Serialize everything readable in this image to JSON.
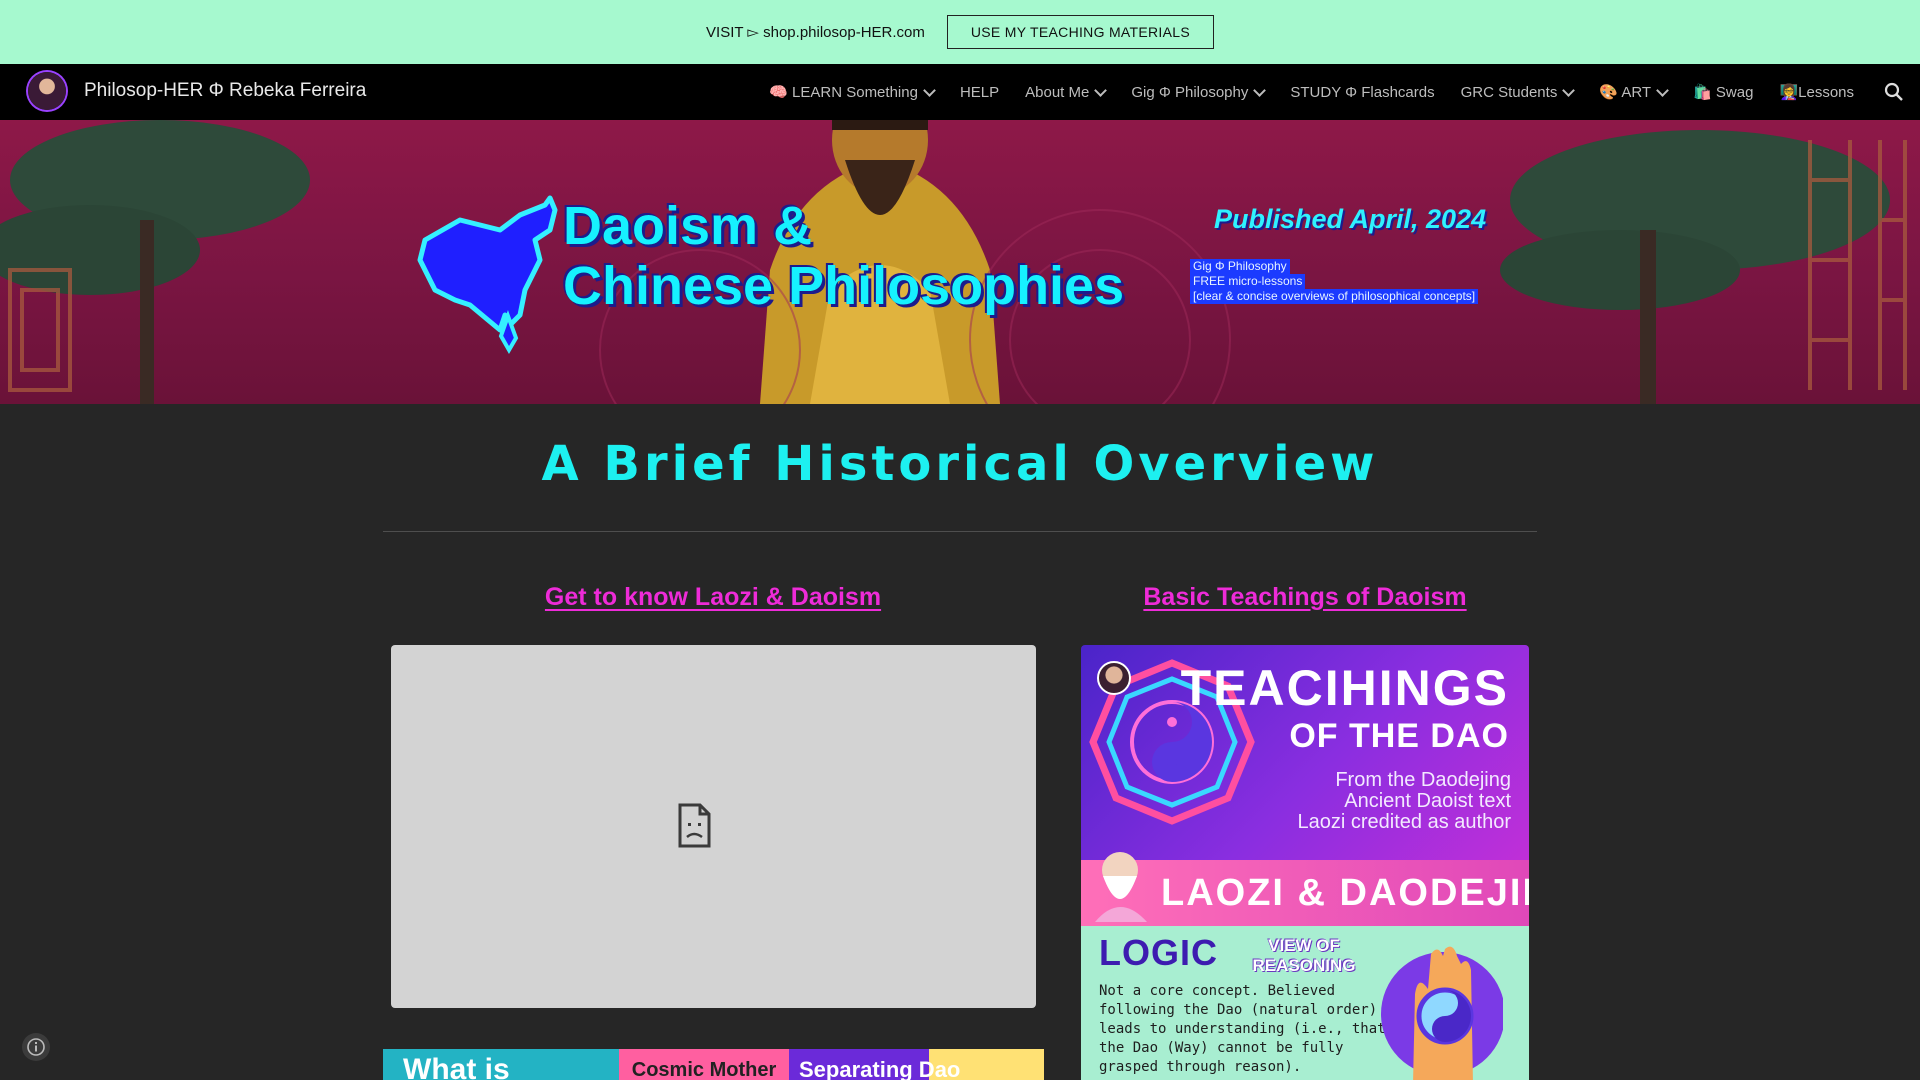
{
  "promo": {
    "text": "VISIT ▻ shop.philosop-HER.com",
    "button_label": "USE MY TEACHING MATERIALS"
  },
  "header": {
    "site_title": "Philosop-HER Φ Rebeka Ferreira",
    "nav": [
      {
        "label": "🧠 LEARN Something",
        "has_dropdown": true
      },
      {
        "label": "HELP",
        "has_dropdown": false
      },
      {
        "label": "About Me",
        "has_dropdown": true
      },
      {
        "label": "Gig Φ Philosophy",
        "has_dropdown": true
      },
      {
        "label": "STUDY Φ Flashcards",
        "has_dropdown": false
      },
      {
        "label": "GRC Students",
        "has_dropdown": true
      },
      {
        "label": "🎨 ART",
        "has_dropdown": true
      },
      {
        "label": "🛍️ Swag",
        "has_dropdown": false
      },
      {
        "label": "👩‍🏫Lessons",
        "has_dropdown": false
      }
    ]
  },
  "hero": {
    "title_line1": "Daoism &",
    "title_line2": "Chinese Philosophies",
    "published": "Published April, 2024",
    "lines": [
      "Gig Φ Philosophy",
      "FREE micro-lessons",
      "[clear & concise overviews of philosophical concepts]"
    ]
  },
  "main": {
    "section_title": "A Brief Historical Overview",
    "left_heading": "Get to know Laozi & Daoism",
    "right_heading": "Basic Teachings of Daoism",
    "bottom_strip": {
      "a": "What is",
      "b": "Cosmic Mother",
      "c": "Separating Dao"
    },
    "infographic": {
      "title1": "TEACIHINGS",
      "title2": "OF THE DAO",
      "subtitle": [
        "From the Daodejing",
        "Ancient Daoist text",
        "Laozi credited as author"
      ],
      "band": "LAOZI & DAODEJING",
      "logic": "LOGIC",
      "view": "VIEW OF REASONING",
      "body": [
        "Not a core concept. Believed",
        "following the Dao (natural order)",
        "leads to understanding (i.e., that",
        "the Dao (Way) cannot be fully",
        "grasped through reason)."
      ]
    }
  },
  "colors": {
    "promo_bg": "#a6f9cf",
    "nav_bg": "#000000",
    "accent_cyan": "#1df0f0",
    "accent_magenta": "#ee2bd8",
    "page_bg": "#262626"
  }
}
